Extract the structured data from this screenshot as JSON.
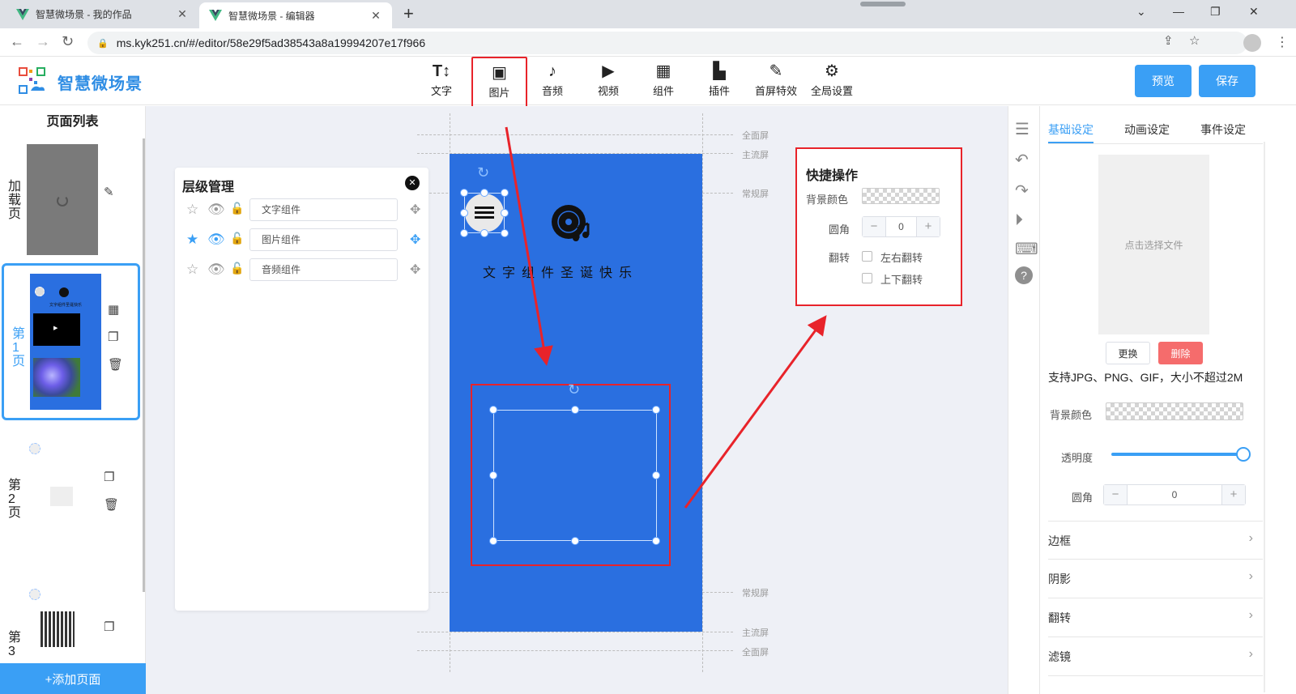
{
  "browser": {
    "tabs": [
      {
        "title": "智慧微场景 - 我的作品",
        "close": "✕"
      },
      {
        "title": "智慧微场景 - 编辑器",
        "close": "✕"
      }
    ],
    "new_tab": "+",
    "url": "ms.kyk251.cn/#/editor/58e29f5ad38543a8a19994207e17f966",
    "window_controls": {
      "minimize": "—",
      "maximize": "❐",
      "close": "✕",
      "dropdown": "⌄"
    }
  },
  "header": {
    "brand": "智慧微场景",
    "toolbar": [
      {
        "label": "文字",
        "icon": "T↕"
      },
      {
        "label": "图片",
        "icon": "▣"
      },
      {
        "label": "音频",
        "icon": "♪"
      },
      {
        "label": "视频",
        "icon": "▶"
      },
      {
        "label": "组件",
        "icon": "▦"
      },
      {
        "label": "插件",
        "icon": "▙"
      },
      {
        "label": "首屏特效",
        "icon": "✎"
      },
      {
        "label": "全局设置",
        "icon": "⚙"
      }
    ],
    "preview_label": "预览",
    "save_label": "保存"
  },
  "page_list": {
    "title": "页面列表",
    "pages": [
      {
        "label": "加载页"
      },
      {
        "label": "第1页"
      },
      {
        "label": "第2页"
      },
      {
        "label": "第3"
      }
    ],
    "thumb_text_1": "文字组件圣诞快乐",
    "add_page_label": "+添加页面"
  },
  "guides": {
    "full": "全面屏",
    "main": "主流屏",
    "normal": "常规屏"
  },
  "phone": {
    "text": "文字组件圣诞快乐"
  },
  "layers": {
    "title": "层级管理",
    "close": "✕",
    "rows": [
      {
        "name": "文字组件",
        "starred": false,
        "active": false
      },
      {
        "name": "图片组件",
        "starred": true,
        "active": true
      },
      {
        "name": "音频组件",
        "starred": false,
        "active": false
      }
    ]
  },
  "quick_ops": {
    "title": "快捷操作",
    "bg_color_label": "背景颜色",
    "radius_label": "圆角",
    "radius_value": "0",
    "flip_label": "翻转",
    "flip_h_label": "左右翻转",
    "flip_v_label": "上下翻转",
    "minus": "−",
    "plus": "+"
  },
  "settings": {
    "tabs": [
      {
        "label": "基础设定",
        "active": true
      },
      {
        "label": "动画设定",
        "active": false
      },
      {
        "label": "事件设定",
        "active": false
      }
    ],
    "upload_placeholder": "点击选择文件",
    "replace_label": "更换",
    "delete_label": "删除",
    "hint": "支持JPG、PNG、GIF，大小不超过2M",
    "bg_color_label": "背景颜色",
    "opacity_label": "透明度",
    "opacity_value": 1.0,
    "radius_label": "圆角",
    "radius_value": "0",
    "minus": "−",
    "plus": "+",
    "accordions": [
      "边框",
      "阴影",
      "翻转",
      "滤镜"
    ],
    "chevron": "›"
  },
  "colors": {
    "accent": "#3a9ff5",
    "phone_bg": "#2a6fe0",
    "highlight": "#e8232a",
    "delete_btn": "#f56c6c"
  }
}
